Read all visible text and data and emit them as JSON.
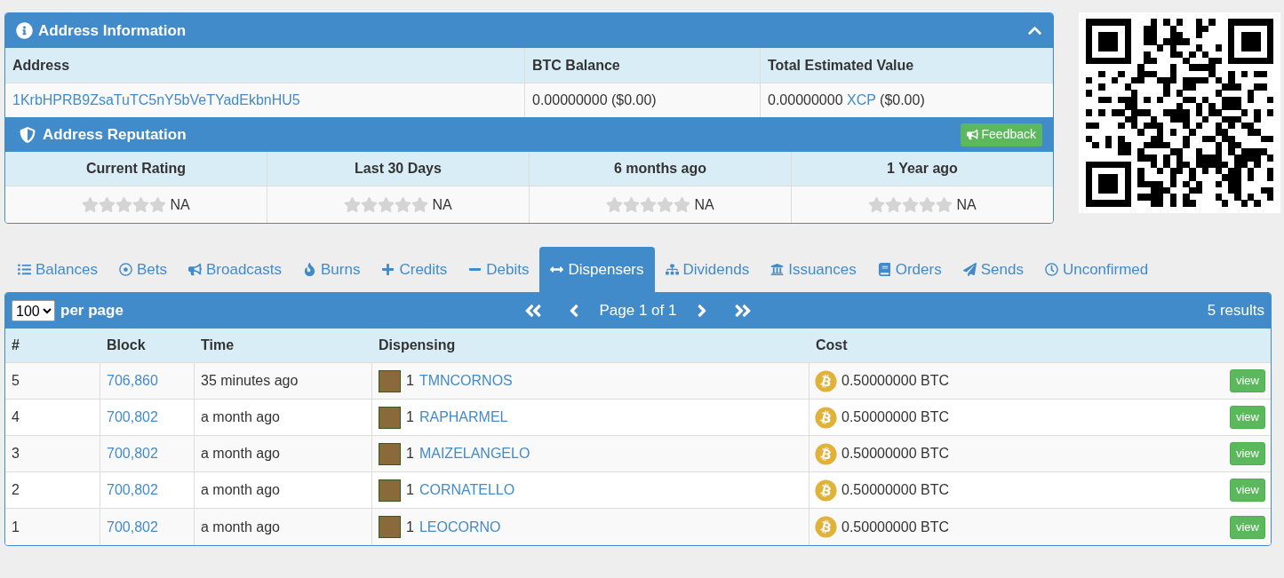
{
  "address_panel": {
    "title": "Address Information",
    "expanded": true,
    "columns": [
      "Address",
      "BTC Balance",
      "Total Estimated Value"
    ],
    "address": "1KrbHPRB9ZsaTuTC5nY5bVeTYadEkbnHU5",
    "btc_balance": "0.00000000 ($0.00)",
    "total_value": {
      "amount": "0.00000000",
      "asset": "XCP",
      "usd": "($0.00)"
    }
  },
  "reputation_panel": {
    "title": "Address Reputation",
    "feedback_button": "Feedback",
    "ratings": [
      {
        "label": "Current Rating",
        "stars": 0,
        "value": "NA"
      },
      {
        "label": "Last 30 Days",
        "stars": 0,
        "value": "NA"
      },
      {
        "label": "6 months ago",
        "stars": 0,
        "value": "NA"
      },
      {
        "label": "1 Year ago",
        "stars": 0,
        "value": "NA"
      }
    ]
  },
  "tabs": [
    {
      "label": "Balances",
      "selected": false
    },
    {
      "label": "Bets",
      "selected": false
    },
    {
      "label": "Broadcasts",
      "selected": false
    },
    {
      "label": "Burns",
      "selected": false
    },
    {
      "label": "Credits",
      "selected": false
    },
    {
      "label": "Debits",
      "selected": false
    },
    {
      "label": "Dispensers",
      "selected": true
    },
    {
      "label": "Dividends",
      "selected": false
    },
    {
      "label": "Issuances",
      "selected": false
    },
    {
      "label": "Orders",
      "selected": false
    },
    {
      "label": "Sends",
      "selected": false
    },
    {
      "label": "Unconfirmed",
      "selected": false
    }
  ],
  "table": {
    "per_page": "100",
    "per_page_label": "per page",
    "page_label": "Page 1 of 1",
    "results": "5 results",
    "columns": [
      "#",
      "Block",
      "Time",
      "Dispensing",
      "Cost"
    ],
    "rows": [
      {
        "index": "5",
        "block": "706,860",
        "time": "35 minutes ago",
        "quantity": "1",
        "asset": "TMNCORNOS",
        "cost": "0.50000000 BTC",
        "action": "view"
      },
      {
        "index": "4",
        "block": "700,802",
        "time": "a month ago",
        "quantity": "1",
        "asset": "RAPHARMEL",
        "cost": "0.50000000 BTC",
        "action": "view"
      },
      {
        "index": "3",
        "block": "700,802",
        "time": "a month ago",
        "quantity": "1",
        "asset": "MAIZELANGELO",
        "cost": "0.50000000 BTC",
        "action": "view"
      },
      {
        "index": "2",
        "block": "700,802",
        "time": "a month ago",
        "quantity": "1",
        "asset": "CORNATELLO",
        "cost": "0.50000000 BTC",
        "action": "view"
      },
      {
        "index": "1",
        "block": "700,802",
        "time": "a month ago",
        "quantity": "1",
        "asset": "LEOCORNO",
        "cost": "0.50000000 BTC",
        "action": "view"
      }
    ]
  }
}
